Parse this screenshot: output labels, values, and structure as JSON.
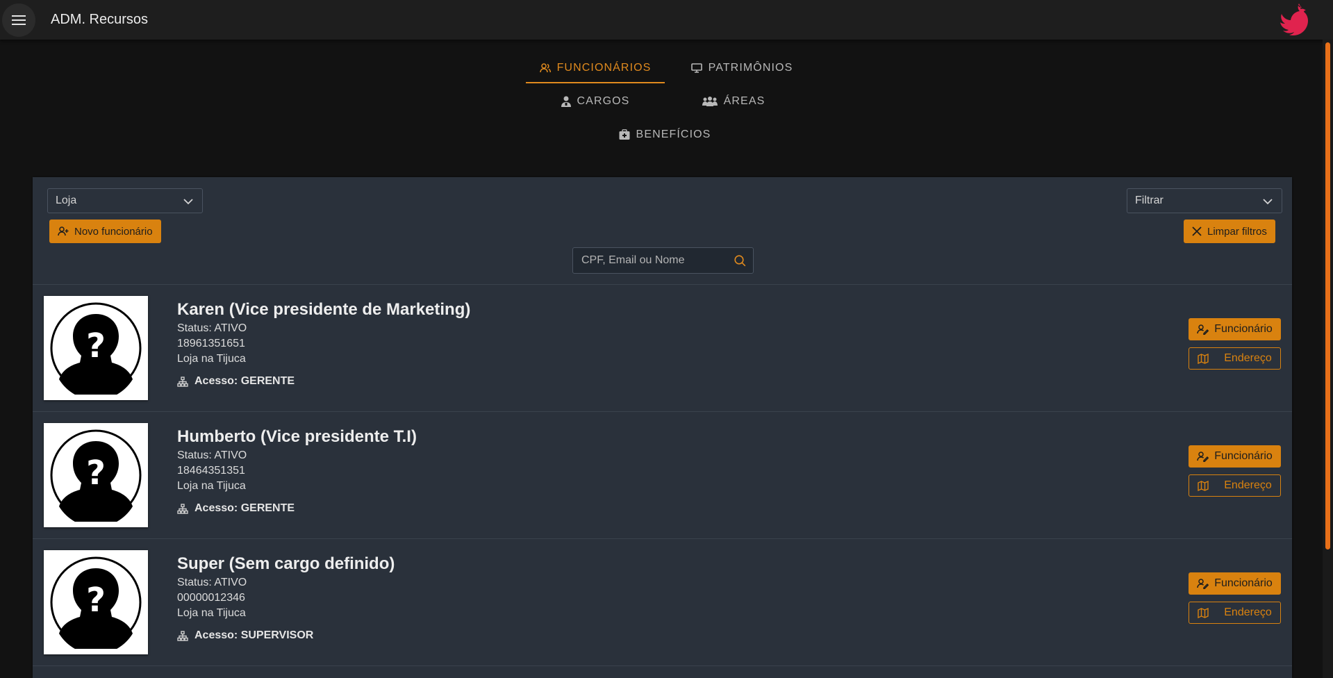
{
  "app": {
    "title": "ADM. Recursos",
    "accent": "#d9820f",
    "logo_color": "#e0234e"
  },
  "tabs": [
    {
      "label": "FUNCIONÁRIOS",
      "icon": "users-icon",
      "active": true
    },
    {
      "label": "PATRIMÔNIOS",
      "icon": "monitor-icon",
      "active": false
    },
    {
      "label": "CARGOS",
      "icon": "person-badge-icon",
      "active": false
    },
    {
      "label": "ÁREAS",
      "icon": "group-icon",
      "active": false
    },
    {
      "label": "BENEFÍCIOS",
      "icon": "medical-bag-icon",
      "active": false
    }
  ],
  "filters": {
    "store_select": "Loja",
    "filter_select": "Filtrar",
    "new_employee": "Novo funcionário",
    "clear_filters": "Limpar filtros",
    "search_placeholder": "CPF, Email ou Nome"
  },
  "employees": [
    {
      "name": "Karen (Vice presidente de Marketing)",
      "status": "Status: ATIVO",
      "cpf": "18961351651",
      "store": "Loja na Tijuca",
      "access": "Acesso: GERENTE"
    },
    {
      "name": "Humberto (Vice presidente T.I)",
      "status": "Status: ATIVO",
      "cpf": "18464351351",
      "store": "Loja na Tijuca",
      "access": "Acesso: GERENTE"
    },
    {
      "name": "Super (Sem cargo definido)",
      "status": "Status: ATIVO",
      "cpf": "00000012346",
      "store": "Loja na Tijuca",
      "access": "Acesso: SUPERVISOR"
    }
  ],
  "row_actions": {
    "employee": "Funcionário",
    "address": "Endereço"
  }
}
